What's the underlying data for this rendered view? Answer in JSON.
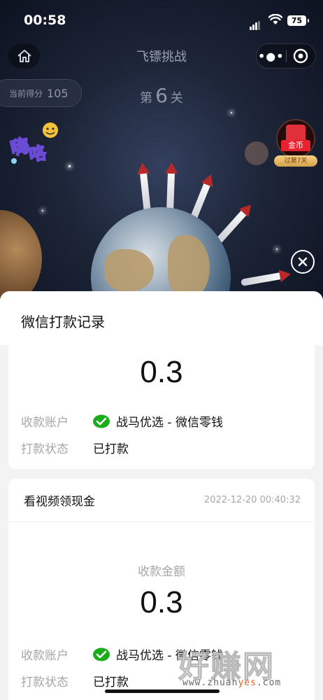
{
  "status_bar": {
    "time": "00:58",
    "battery": "75"
  },
  "nav": {
    "title": "飞镖挑战"
  },
  "game": {
    "score_label": "当前得分",
    "score_value": "105",
    "level_prefix": "第",
    "level_number": "6",
    "level_suffix": "关",
    "redpack_label": "金币",
    "redpack_tag": "过第7关"
  },
  "sheet": {
    "title": "微信打款记录",
    "record1": {
      "amount": "0.3",
      "account_label": "收款账户",
      "account_value": "战马优选 - 微信零钱",
      "status_label": "打款状态",
      "status_value": "已打款"
    },
    "record2": {
      "title": "看视频领现金",
      "timestamp": "2022-12-20 00:40:32",
      "amount_label": "收款金额",
      "amount": "0.3",
      "account_label": "收款账户",
      "account_value": "战马优选 - 微信零钱",
      "status_label": "打款状态",
      "status_value": "已打款"
    }
  },
  "watermark": {
    "big": "好赚网",
    "small_prefix": "www.zhuan",
    "small_highlight": "yes",
    "small_suffix": ".com"
  },
  "icons": {
    "home": "home-icon",
    "more": "more-dots-icon",
    "target": "target-icon",
    "close": "close-icon",
    "wechat": "wechat-pay-icon"
  },
  "colors": {
    "wechat_green": "#1aad19",
    "redpack": "#e8222f"
  }
}
